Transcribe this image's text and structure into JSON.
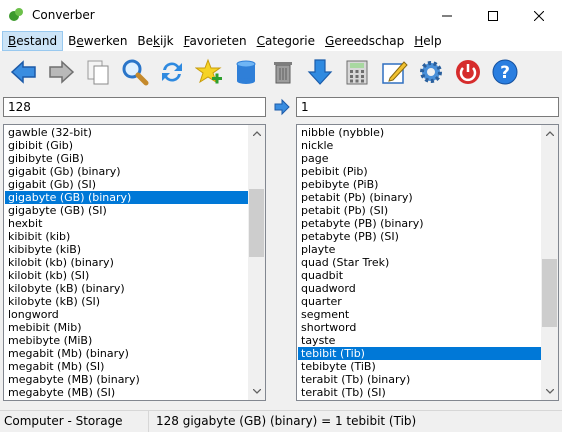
{
  "window": {
    "title": "Converber"
  },
  "menu": [
    {
      "label": "Bestand",
      "key": "B",
      "rest": "estand",
      "active": true
    },
    {
      "label": "Bewerken",
      "key": "e",
      "pre": "B",
      "rest": "werken"
    },
    {
      "label": "Bekijk",
      "key": "k",
      "pre": "Be",
      "rest": "ijk"
    },
    {
      "label": "Favorieten",
      "key": "F",
      "rest": "avorieten"
    },
    {
      "label": "Categorie",
      "key": "C",
      "rest": "ategorie"
    },
    {
      "label": "Gereedschap",
      "key": "G",
      "rest": "ereedschap"
    },
    {
      "label": "Help",
      "key": "H",
      "rest": "elp"
    }
  ],
  "toolbar": {
    "buttons": [
      "back-icon",
      "forward-icon",
      "copy-icon",
      "search-icon",
      "swap-icon",
      "add-favorite-icon",
      "database-icon",
      "delete-icon",
      "download-icon",
      "calculator-icon",
      "edit-icon",
      "settings-icon",
      "power-icon",
      "help-icon"
    ]
  },
  "input": {
    "from_value": "128",
    "to_value": "1"
  },
  "left_list": {
    "items": [
      "gawble (32-bit)",
      "gibibit (Gib)",
      "gibibyte (GiB)",
      "gigabit (Gb) (binary)",
      "gigabit (Gb) (SI)",
      "gigabyte (GB) (binary)",
      "gigabyte (GB) (SI)",
      "hexbit",
      "kibibit (kib)",
      "kibibyte (kiB)",
      "kilobit (kb) (binary)",
      "kilobit (kb) (SI)",
      "kilobyte (kB) (binary)",
      "kilobyte (kB) (SI)",
      "longword",
      "mebibit (Mib)",
      "mebibyte (MiB)",
      "megabit (Mb) (binary)",
      "megabit (Mb) (SI)",
      "megabyte (MB) (binary)",
      "megabyte (MB) (SI)"
    ],
    "selected": "gigabyte (GB) (binary)"
  },
  "right_list": {
    "items": [
      "nibble (nybble)",
      "nickle",
      "page",
      "pebibit (Pib)",
      "pebibyte (PiB)",
      "petabit (Pb) (binary)",
      "petabit (Pb) (SI)",
      "petabyte (PB) (binary)",
      "petabyte (PB) (SI)",
      "playte",
      "quad (Star Trek)",
      "quadbit",
      "quadword",
      "quarter",
      "segment",
      "shortword",
      "tayste",
      "tebibit (Tib)",
      "tebibyte (TiB)",
      "terabit (Tb) (binary)",
      "terabit (Tb) (SI)"
    ],
    "selected": "tebibit (Tib)"
  },
  "status": {
    "category": "Computer - Storage",
    "result": "128 gigabyte (GB) (binary) = 1 tebibit (Tib)"
  }
}
